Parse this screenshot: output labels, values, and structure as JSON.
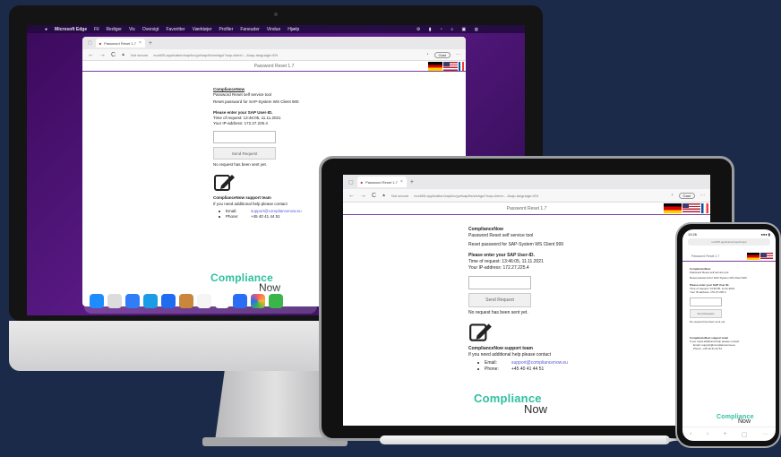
{
  "imac": {
    "menubar": {
      "app": "Microsoft Edge",
      "items": [
        "Fil",
        "Rediger",
        "Vis",
        "Oversigt",
        "Favoritter",
        "Værktøjer",
        "Profiler",
        "Faneuder",
        "Vindue",
        "Hjælp"
      ],
      "status_icons": "⚙ ▮ ◔ ⌕ ▣ ◍"
    },
    "browser": {
      "tab_title": "Password Reset 1.7",
      "tab_close": "×",
      "new_tab": "+",
      "back": "←",
      "forward": "→",
      "reload": "C",
      "security": "Not secure",
      "url": "ecc605.application/sap/bc/gui/sap/its/webgui?sap-client=...&sap-language=EN",
      "guest": "Gast",
      "menu": "···"
    },
    "dock_colors": [
      "#1e8cff",
      "#f7f7f7",
      "#2f7ef8",
      "#1c9be6",
      "#1e6cf0",
      "#c8873a",
      "#e94e4e",
      "#f5f5f5",
      "#ffffff",
      "#2a6ef5",
      "#ff5a5f",
      "#39b54a"
    ]
  },
  "page": {
    "title": "Password Reset 1.7",
    "brand": "ComplianceNow",
    "line1": "Password Reset self service tool",
    "line2": "Reset password for SAP-System WS Client 900",
    "prompt": "Please enter your SAP User-ID.",
    "time_of_request": "Time of request: 13:46:05, 11.11.2021",
    "ip_address": "Your IP-address: 172.27.225.4",
    "send_button": "Send Request",
    "no_request": "No request has been sent yet.",
    "support_title": "ComplianceNow support team",
    "support_text": "If you need additional help please contact",
    "email_label": "Email:",
    "email_value": "support@compliancenow.eu",
    "phone_label": "Phone:",
    "phone_value": "+45 40 41 44 51"
  },
  "logo": {
    "word1": "Compliance",
    "word2": "Now"
  },
  "ipad": {
    "tab_title": "Password Reset 1.7",
    "tab_close": "×",
    "new_tab": "+",
    "back": "←",
    "forward": "→",
    "reload": "C",
    "security": "Not secure",
    "url": "ecc605.application/sap/bc/gui/sap/its/webgui?sap-client=...&sap-language=EN",
    "guest": "Gast",
    "menu": "···"
  },
  "iphone": {
    "time": "13:26",
    "signal": "●●● ▮",
    "url": "ecc605.application/sap/bc/gui",
    "page_title": "Password Reset 1.7",
    "toolbar": [
      "‹",
      "›",
      "+",
      "▢",
      "···"
    ]
  }
}
